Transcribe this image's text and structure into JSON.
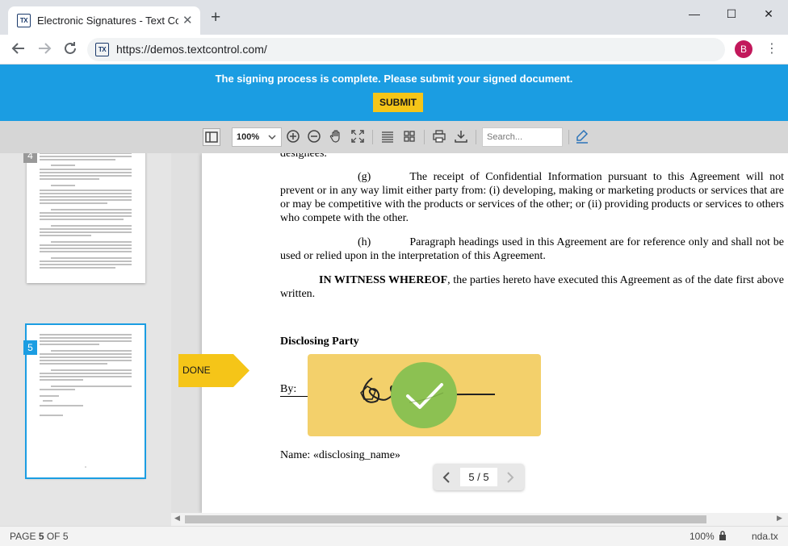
{
  "browser": {
    "tab_title": "Electronic Signatures - Text Control",
    "tab_close": "✕",
    "new_tab": "+",
    "favicon_text": "TX",
    "url": "https://demos.textcontrol.com/",
    "profile_initial": "B",
    "window_controls": {
      "minimize": "—",
      "maximize": "☐",
      "close": "✕"
    },
    "kebab": "⋮"
  },
  "banner": {
    "message": "The signing process is complete. Please submit your signed document.",
    "submit_label": "SUBMIT",
    "color": "#1b9de2",
    "button_color": "#f5c518"
  },
  "viewer_toolbar": {
    "zoom_value": "100%",
    "search_placeholder": "Search...",
    "icons": [
      "sidebar-toggle-icon",
      "zoom-in-icon",
      "zoom-out-icon",
      "pan-hand-icon",
      "fit-screen-icon",
      "text-layout-icon",
      "thumbnails-grid-icon",
      "print-icon",
      "download-icon",
      "signature-pen-icon"
    ]
  },
  "thumbnails": {
    "prev_page_badge": "4",
    "current_page_badge": "5"
  },
  "document": {
    "top_fragment": "designees.",
    "para_g_label": "(g)",
    "para_g_text": "The receipt of Confidential Information pursuant to this Agreement will not prevent or in any way limit either party from: (i) developing, making or marketing products or services that are or may be competitive with the products or services of the other; or (ii) providing products or services to others who compete with the other.",
    "para_h_label": "(h)",
    "para_h_text": "Paragraph headings used in this Agreement are for reference only and shall not be used or relied upon in the interpretation of this Agreement.",
    "witness_bold": "IN WITNESS WHEREOF",
    "witness_text": ", the parties hereto have executed this Agreement as of the date first above written.",
    "disclosing_party": "Disclosing Party",
    "by_label": "By:",
    "name_line": "Name: «disclosing_name»",
    "done_label": "DONE",
    "signature_box_color": "#f3d06b",
    "check_color": "#8cc152"
  },
  "page_nav": {
    "prev": "‹",
    "next": "›",
    "current": "5 / 5"
  },
  "status_bar": {
    "page_label": "PAGE",
    "page_current": "5",
    "page_of": "OF 5",
    "zoom": "100%",
    "lock_icon": "🔒",
    "filename": "nda.tx"
  }
}
